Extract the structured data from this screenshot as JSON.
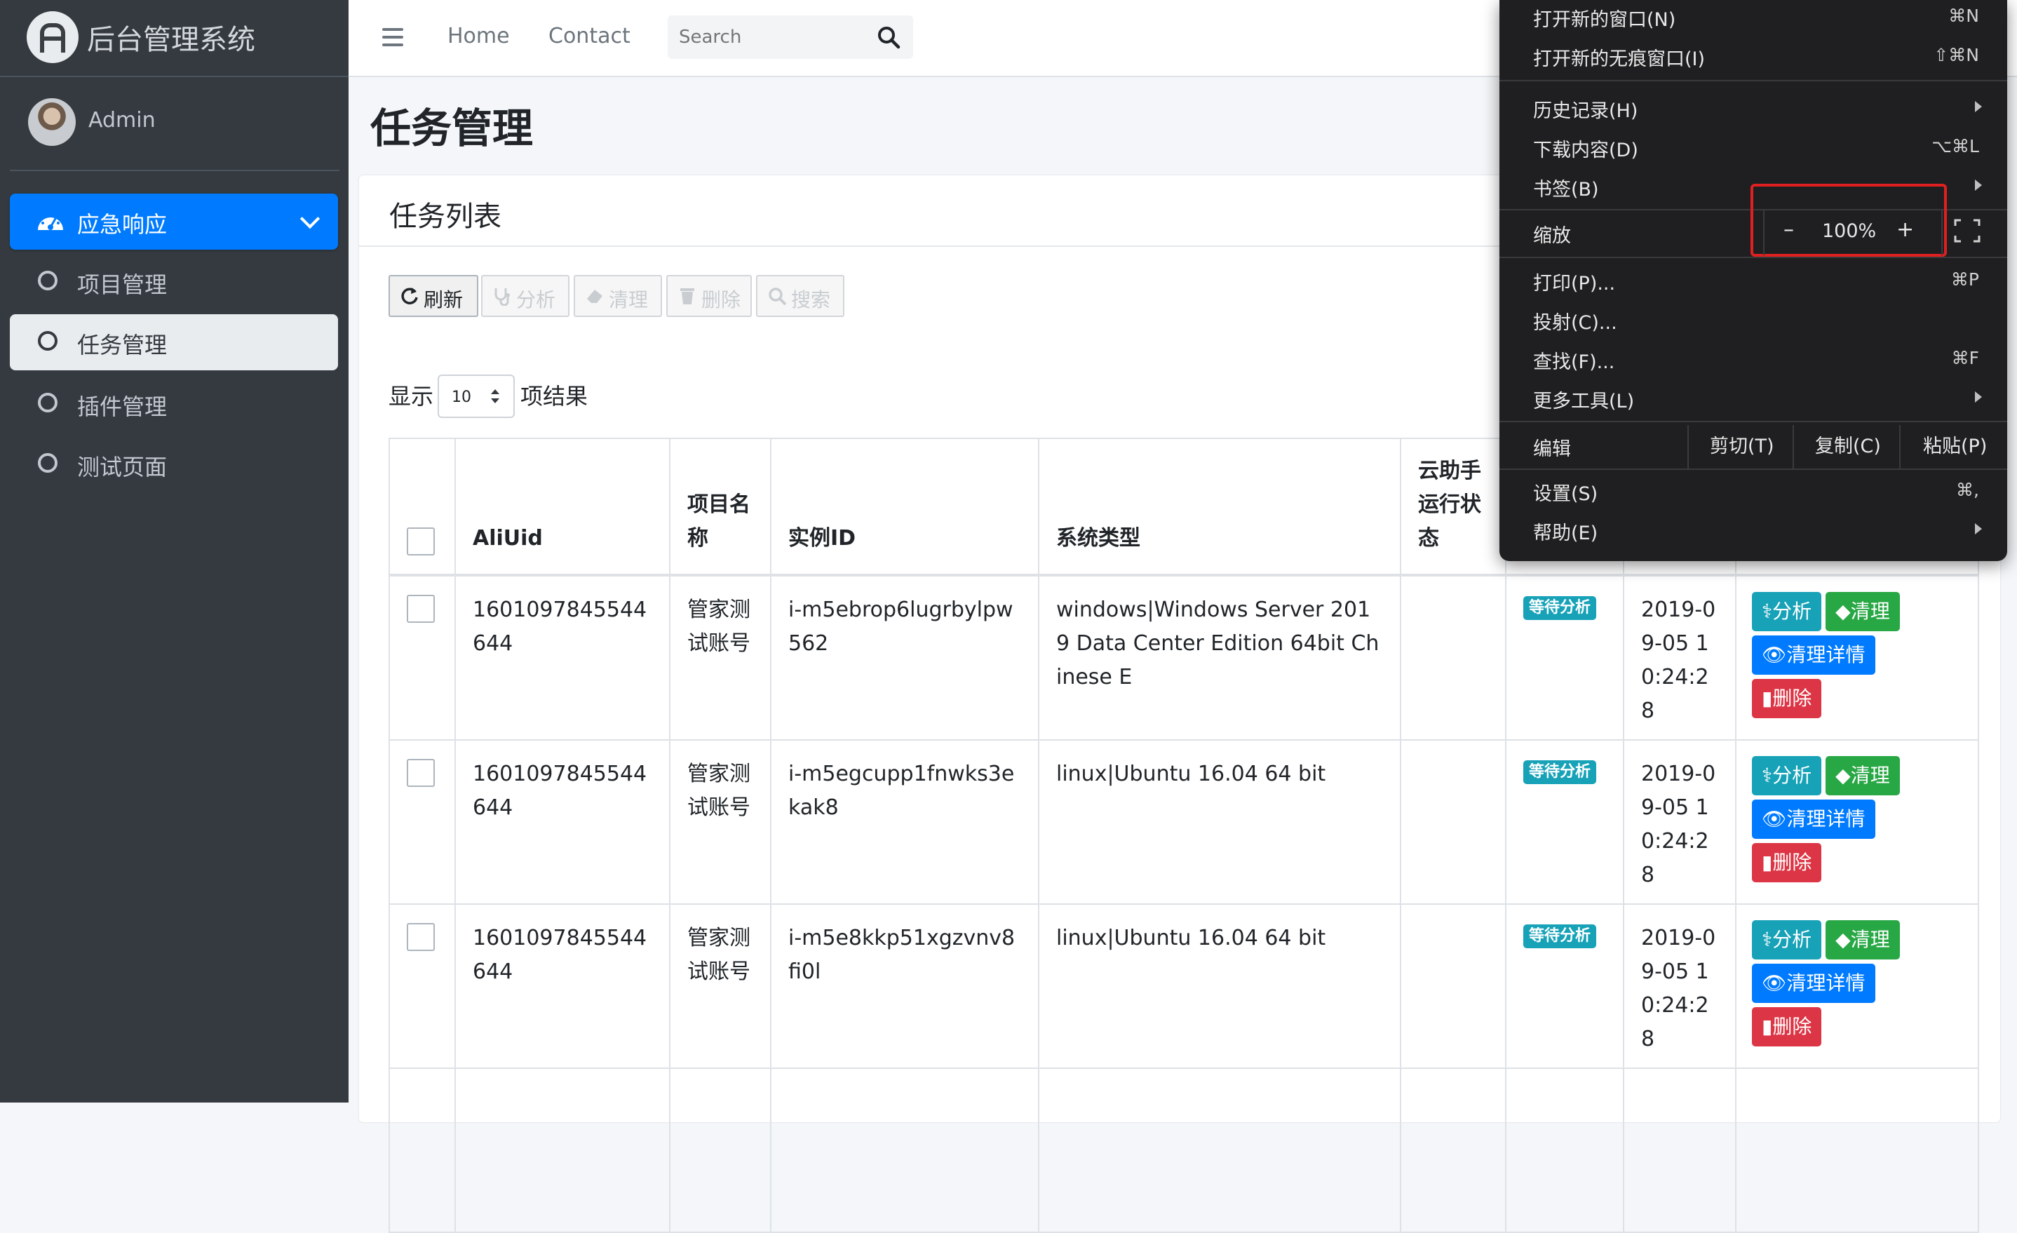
{
  "sidebar": {
    "brand": "后台管理系统",
    "user": "Admin",
    "items": [
      {
        "label": "应急响应"
      },
      {
        "label": "项目管理"
      },
      {
        "label": "任务管理"
      },
      {
        "label": "插件管理"
      },
      {
        "label": "测试页面"
      }
    ]
  },
  "navbar": {
    "links": [
      "Home",
      "Contact"
    ],
    "search_placeholder": "Search"
  },
  "page": {
    "title": "任务管理",
    "card_title": "任务列表"
  },
  "toolbar": {
    "buttons": [
      {
        "label": "刷新",
        "icon": "refresh-icon",
        "enabled": true
      },
      {
        "label": "分析",
        "icon": "stethoscope-icon",
        "enabled": false
      },
      {
        "label": "清理",
        "icon": "eraser-icon",
        "enabled": false
      },
      {
        "label": "删除",
        "icon": "trash-icon",
        "enabled": false
      },
      {
        "label": "搜索",
        "icon": "search-icon",
        "enabled": false
      }
    ]
  },
  "length": {
    "prefix": "显示",
    "value": "10",
    "suffix": "项结果"
  },
  "table": {
    "headers": [
      "AliUid",
      "项目名称",
      "实例ID",
      "系统类型",
      "云助手运行状态",
      "",
      "",
      ""
    ],
    "rows": [
      {
        "aliuid": "1601097845544644",
        "project": "管家测试账号",
        "instance": "i-m5ebrop6lugrbylpw562",
        "os": "windows|Windows Server 2019 Data Center Edition 64bit Chinese E",
        "status": "",
        "badge": "等待分析",
        "time": "2019-09-05 10:24:28"
      },
      {
        "aliuid": "1601097845544644",
        "project": "管家测试账号",
        "instance": "i-m5egcupp1fnwks3ekak8",
        "os": "linux|Ubuntu 16.04 64 bit",
        "status": "",
        "badge": "等待分析",
        "time": "2019-09-05 10:24:28"
      },
      {
        "aliuid": "1601097845544644",
        "project": "管家测试账号",
        "instance": "i-m5e8kkp51xgzvnv8fi0l",
        "os": "linux|Ubuntu 16.04 64 bit",
        "status": "",
        "badge": "等待分析",
        "time": "2019-09-05 10:24:28"
      }
    ],
    "row_actions": {
      "analyze": "分析",
      "clean": "清理",
      "details": "清理详情",
      "delete": "删除"
    }
  },
  "context_menu": {
    "new_window": {
      "label": "打开新的窗口(N)",
      "shortcut": "⌘N"
    },
    "new_incognito": {
      "label": "打开新的无痕窗口(I)",
      "shortcut": "⇧⌘N"
    },
    "history": {
      "label": "历史记录(H)"
    },
    "downloads": {
      "label": "下载内容(D)",
      "shortcut": "⌥⌘L"
    },
    "bookmarks": {
      "label": "书签(B)"
    },
    "zoom": {
      "label": "缩放",
      "minus": "–",
      "value": "100%",
      "plus": "+"
    },
    "print": {
      "label": "打印(P)...",
      "shortcut": "⌘P"
    },
    "cast": {
      "label": "投射(C)..."
    },
    "find": {
      "label": "查找(F)...",
      "shortcut": "⌘F"
    },
    "more_tools": {
      "label": "更多工具(L)"
    },
    "edit": {
      "label": "编辑",
      "cut": "剪切(T)",
      "copy": "复制(C)",
      "paste": "粘贴(P)"
    },
    "settings": {
      "label": "设置(S)",
      "shortcut": "⌘,"
    },
    "help": {
      "label": "帮助(E)"
    }
  },
  "colors": {
    "sidebar_bg": "#343a40",
    "primary": "#007bff",
    "info": "#17a2b8",
    "success": "#28a745",
    "danger": "#dc3545",
    "menu_bg": "#1f1f21",
    "highlight": "#e02020"
  }
}
